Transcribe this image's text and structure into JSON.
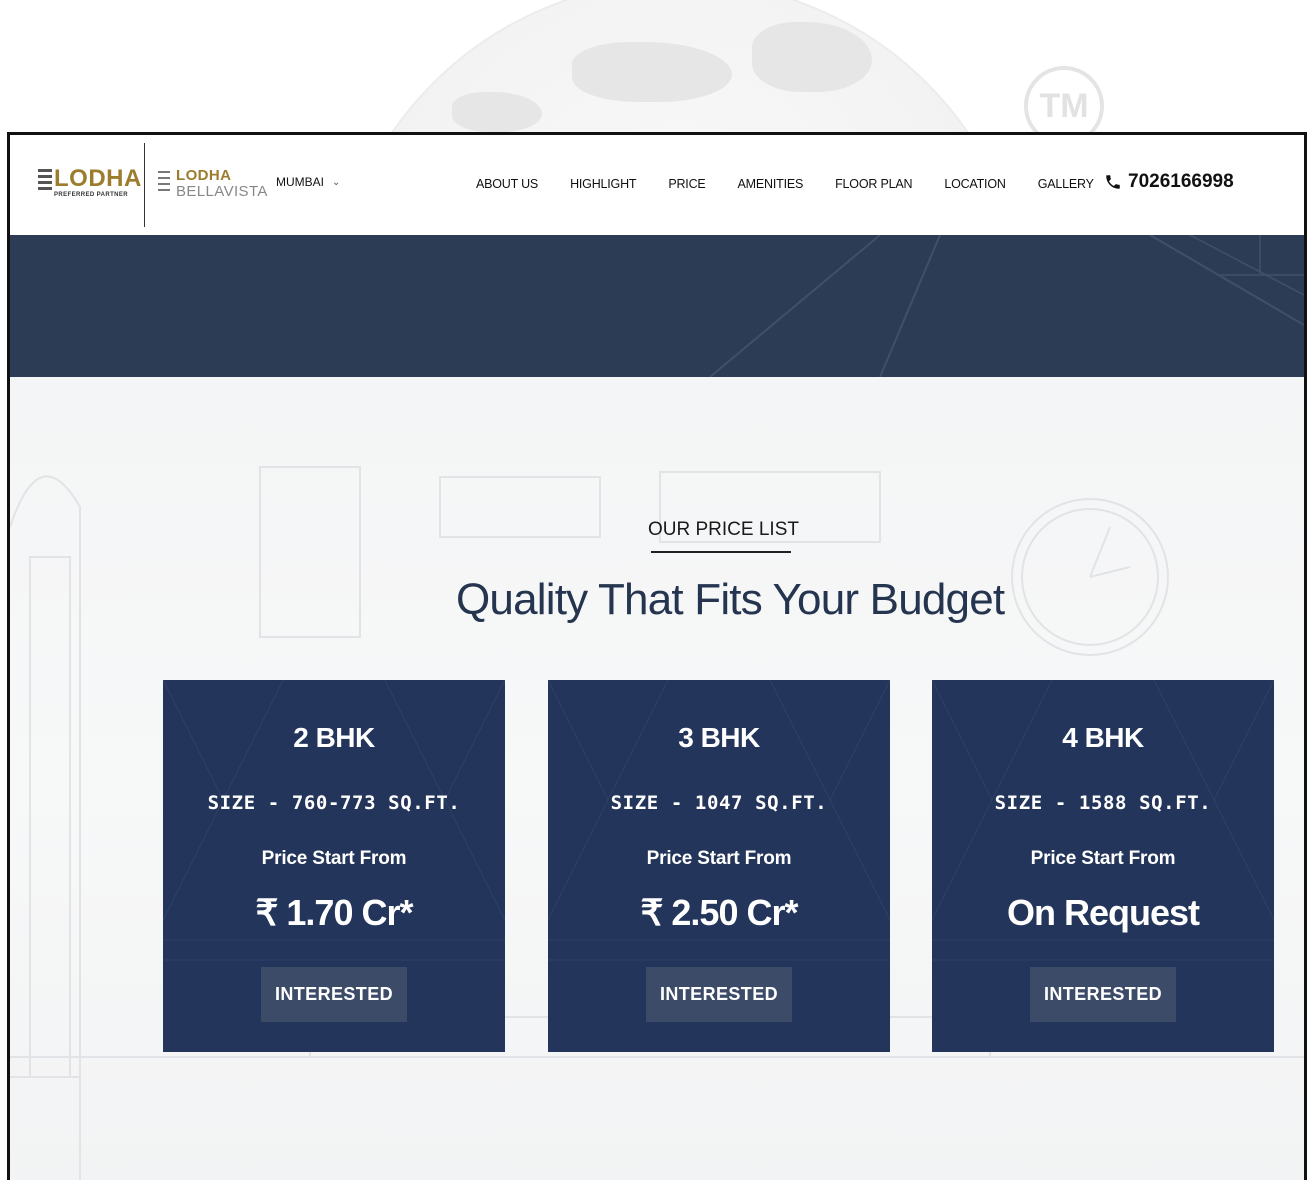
{
  "watermark": {
    "mark": "TM"
  },
  "brand": {
    "logo_primary": "LODHA",
    "logo_primary_sub": "PREFERRED PARTNER",
    "logo_secondary_top": "LODHA",
    "logo_secondary_bottom": "BELLAVISTA"
  },
  "nav": {
    "city": "MUMBAI",
    "links": [
      "ABOUT US",
      "HIGHLIGHT",
      "PRICE",
      "AMENITIES",
      "FLOOR PLAN",
      "LOCATION",
      "GALLERY"
    ],
    "phone": "7026166998"
  },
  "section": {
    "eyebrow": "OUR PRICE LIST",
    "headline": "Quality That Fits Your Budget"
  },
  "cards": [
    {
      "title": "2 BHK",
      "size": "SIZE - 760-773 SQ.FT.",
      "label": "Price Start From",
      "price": "₹ 1.70 Cr*",
      "button": "INTERESTED"
    },
    {
      "title": "3 BHK",
      "size": "SIZE - 1047 SQ.FT.",
      "label": "Price Start From",
      "price": "₹ 2.50 Cr*",
      "button": "INTERESTED"
    },
    {
      "title": "4 BHK",
      "size": "SIZE - 1588 SQ.FT.",
      "label": "Price Start From",
      "price": "On Request",
      "button": "INTERESTED"
    }
  ],
  "colors": {
    "navy": "#23355a",
    "banner": "#2d3c55",
    "gold": "#9c7d2d",
    "button": "#3b4b68",
    "headline": "#25344f"
  }
}
